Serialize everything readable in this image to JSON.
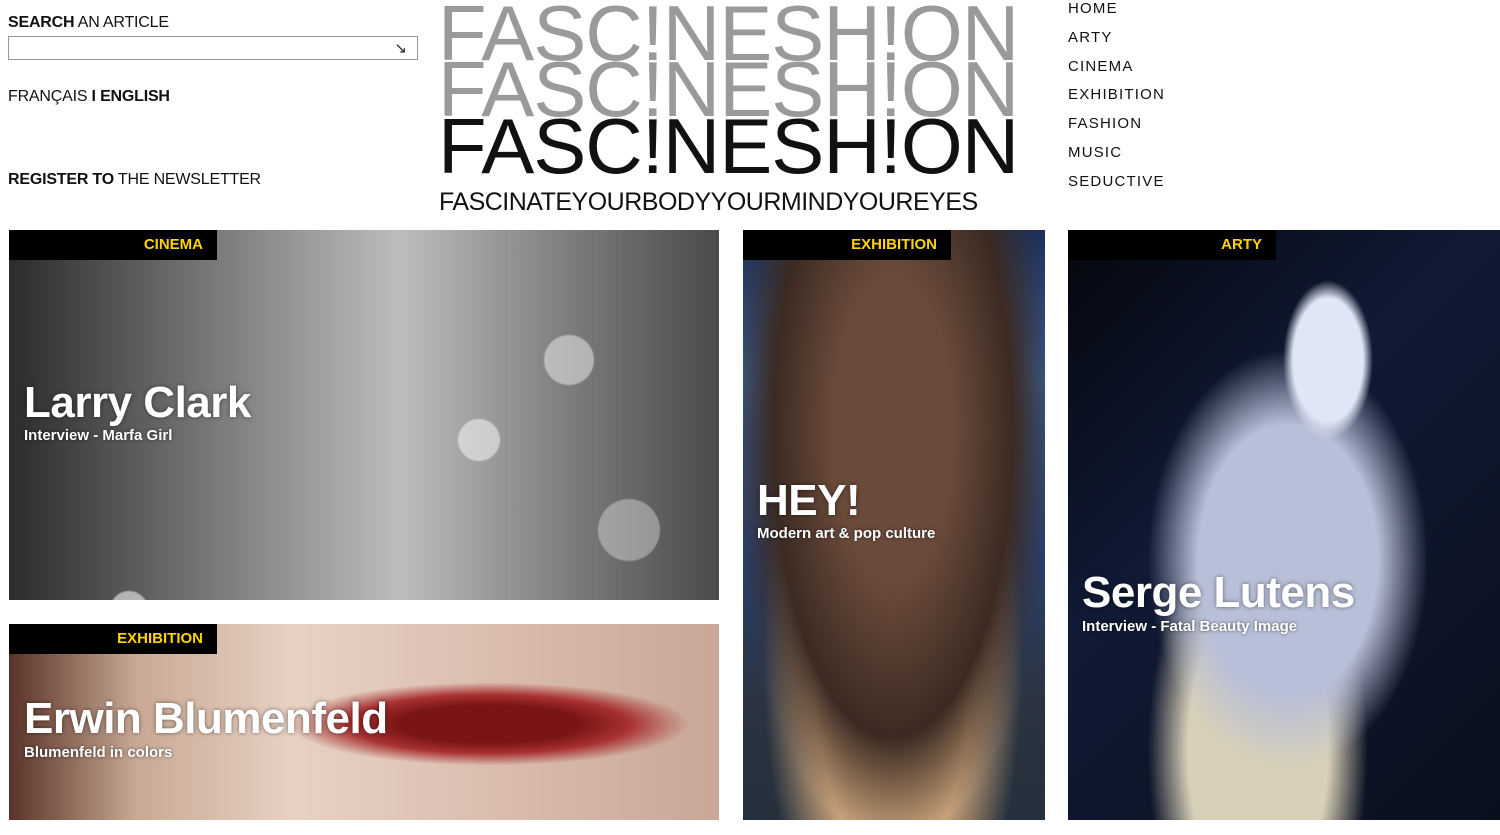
{
  "header": {
    "search": {
      "label_strong": "SEARCH",
      "label_rest": " AN ARTICLE",
      "value": "",
      "go_glyph": "↘"
    },
    "language": {
      "francais": "FRANÇAIS",
      "separator": " I ",
      "english": "ENGLISH"
    },
    "newsletter": {
      "strong": "REGISTER TO",
      "rest": " THE NEWSLETTER"
    }
  },
  "logo": {
    "wordmark": "FASC!NESH!ON",
    "tagline": "FASCINATEYOURBODYYOURMINDYOUREYES"
  },
  "nav": {
    "items": [
      "HOME",
      "ARTY",
      "CINEMA",
      "EXHIBITION",
      "FASHION",
      "MUSIC",
      "SEDUCTIVE"
    ]
  },
  "tiles": [
    {
      "tag": "CINEMA",
      "title": "Larry Clark",
      "subtitle": "Interview - Marfa Girl"
    },
    {
      "tag": "EXHIBITION",
      "title": "Erwin Blumenfeld",
      "subtitle": "Blumenfeld in colors"
    },
    {
      "tag": "EXHIBITION",
      "title": "HEY!",
      "subtitle": "Modern art & pop culture"
    },
    {
      "tag": "ARTY",
      "title": "Serge Lutens",
      "subtitle": "Interview - Fatal Beauty Image"
    }
  ],
  "colors": {
    "tag_text": "#ffd400",
    "tag_bg": "#000000",
    "logo_light": "#9a9a9a",
    "logo_dark": "#111111"
  }
}
